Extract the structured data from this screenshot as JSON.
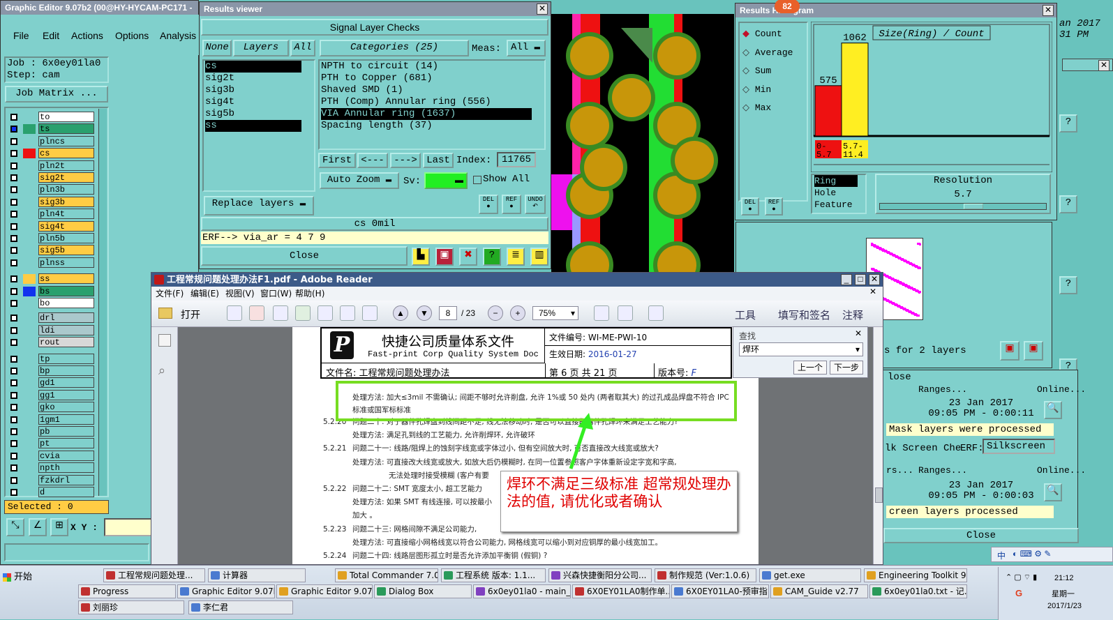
{
  "graphic_editor": {
    "title": "Graphic Editor 9.07b2 (00@HY-HYCAM-PC171 -",
    "menu": [
      "File",
      "Edit",
      "Actions",
      "Options",
      "Analysis"
    ],
    "job": "Job : 6x0ey01la0",
    "step": "Step: cam",
    "job_matrix": "Job Matrix ...",
    "layers": [
      {
        "name": "to",
        "color": "#ffffff",
        "swatch": ""
      },
      {
        "name": "ts",
        "color": "#2aa06e",
        "swatch": "#2aa06e"
      },
      {
        "name": "plncs",
        "color": "#80d0cc",
        "swatch": ""
      },
      {
        "name": "cs",
        "color": "#ffcc44",
        "swatch": "#ee1111"
      },
      {
        "name": "pln2t",
        "color": "#80d0cc",
        "swatch": ""
      },
      {
        "name": "sig2t",
        "color": "#ffcc44",
        "swatch": ""
      },
      {
        "name": "pln3b",
        "color": "#80d0cc",
        "swatch": ""
      },
      {
        "name": "sig3b",
        "color": "#ffcc44",
        "swatch": ""
      },
      {
        "name": "pln4t",
        "color": "#80d0cc",
        "swatch": ""
      },
      {
        "name": "sig4t",
        "color": "#ffcc44",
        "swatch": ""
      },
      {
        "name": "pln5b",
        "color": "#80d0cc",
        "swatch": ""
      },
      {
        "name": "sig5b",
        "color": "#ffcc44",
        "swatch": ""
      },
      {
        "name": "plnss",
        "color": "#80d0cc",
        "swatch": ""
      },
      {
        "name": "ss",
        "color": "#ffcc44",
        "swatch": "#ffcc44"
      },
      {
        "name": "bs",
        "color": "#2aa06e",
        "swatch": "#1133ee"
      },
      {
        "name": "bo",
        "color": "#ffffff",
        "swatch": ""
      },
      {
        "name": "drl",
        "color": "#aac8cc",
        "swatch": ""
      },
      {
        "name": "ldi",
        "color": "#aac8cc",
        "swatch": ""
      },
      {
        "name": "rout",
        "color": "#d8d8d8",
        "swatch": ""
      },
      {
        "name": "tp",
        "color": "#80d0cc",
        "swatch": ""
      },
      {
        "name": "bp",
        "color": "#80d0cc",
        "swatch": ""
      },
      {
        "name": "gd1",
        "color": "#80d0cc",
        "swatch": ""
      },
      {
        "name": "gg1",
        "color": "#80d0cc",
        "swatch": ""
      },
      {
        "name": "gko",
        "color": "#80d0cc",
        "swatch": ""
      },
      {
        "name": "1gm1",
        "color": "#80d0cc",
        "swatch": ""
      },
      {
        "name": "pb",
        "color": "#80d0cc",
        "swatch": ""
      },
      {
        "name": "pt",
        "color": "#80d0cc",
        "swatch": ""
      },
      {
        "name": "cvia",
        "color": "#80d0cc",
        "swatch": ""
      },
      {
        "name": "npth",
        "color": "#80d0cc",
        "swatch": ""
      },
      {
        "name": "fzkdrl",
        "color": "#80d0cc",
        "swatch": ""
      },
      {
        "name": "d",
        "color": "#80d0cc",
        "swatch": ""
      }
    ],
    "selected": "Selected : 0",
    "xy_label": "X Y :"
  },
  "results_viewer": {
    "title": "Results viewer",
    "header": "Signal Layer Checks",
    "none_btn": "None",
    "layers_btn": "Layers",
    "all_btn": "All",
    "categories_btn": "Categories (25)",
    "meas_label": "Meas:",
    "meas_value": "All",
    "layer_list": [
      "cs",
      "sig2t",
      "sig3b",
      "sig4t",
      "sig5b",
      "ss"
    ],
    "categories": [
      "NPTH to circuit (14)",
      "PTH to Copper (681)",
      "Shaved SMD (1)",
      "PTH (Comp) Annular ring (556)",
      "VIA Annular ring (1637)",
      "Spacing length (37)"
    ],
    "first": "First",
    "prev": "<---",
    "next": "--->",
    "last": "Last",
    "index_label": "Index:",
    "index_value": "11765",
    "auto_zoom": "Auto Zoom",
    "sv_label": "Sv:",
    "show_all": "Show All",
    "replace_layers": "Replace layers",
    "del": "DEL",
    "ref": "REF",
    "undo": "UNDO",
    "status": "cs 0mil",
    "erf": "ERF--> via_ar = 4 7 9",
    "close": "Close"
  },
  "histogram": {
    "title": "Results Histogram",
    "badge": "82",
    "options": [
      "Count",
      "Average",
      "Sum",
      "Min",
      "Max"
    ],
    "chart_data": {
      "type": "bar",
      "title": "Size(Ring) / Count",
      "categories": [
        "0-5.7",
        "5.7-11.4"
      ],
      "values": [
        575,
        1062
      ],
      "colors": [
        "#ee1111",
        "#ffee22"
      ]
    },
    "side_list": [
      "Ring",
      "Hole",
      "Feature"
    ],
    "resolution_label": "Resolution",
    "resolution_value": "5.7",
    "del": "DEL",
    "ref": "REF"
  },
  "bg_right": {
    "date_fragment": "an 2017",
    "time_fragment": "31 PM",
    "for_layers": "s for 2 layers",
    "close_fragment": "lose",
    "ranges": "Ranges...",
    "online": "Online...",
    "time1a": "23 Jan 2017",
    "time1b": "09:05 PM - 0:00:11",
    "mask_msg": "Mask layers were processed",
    "silk_check": "lk Screen Che",
    "erf_label": "ERF:",
    "erf_value": "Silkscreen",
    "ranges2": "Ranges...",
    "online2": "Online...",
    "rs2": "rs...",
    "time2a": "23 Jan 2017",
    "time2b": "09:05 PM - 0:00:03",
    "screen_msg": "creen layers processed",
    "close": "Close",
    "help": "?"
  },
  "adobe": {
    "title": "工程常规问题处理办法F1.pdf - Adobe Reader",
    "menu": [
      "文件(F)",
      "编辑(E)",
      "视图(V)",
      "窗口(W)",
      "帮助(H)"
    ],
    "open": "打开",
    "page_current": "8",
    "page_total": "/ 23",
    "zoom": "75%",
    "tools": "工具",
    "fill_sign": "填写和签名",
    "comment": "注释",
    "find_title": "查找",
    "find_value": "焊环",
    "find_prev": "上一个",
    "find_next": "下一步",
    "doc_header": {
      "company": "快捷公司质量体系文件",
      "company_en": "Fast-print Corp Quality System Doc",
      "doc_no_label": "文件编号:",
      "doc_no": "WI-ME-PWI-10",
      "eff_label": "生效日期:",
      "eff_date": "2016-01-27",
      "file_name": "文件名: 工程常规问题处理办法",
      "page_info": "第 6 页 共 21 页",
      "version_label": "版本号:",
      "version": "F"
    },
    "highlight_text": "处理方法: 加大≤3mil 不需确认; 间距不够时允许削盘, 允许 1%或 50 处内 (两者取其大) 的过孔成品焊盘不符合 IPC 标准或国军标标准",
    "body_lines": [
      {
        "num": "5.2.20",
        "text": "问题二十: 对于器件孔焊盘到线间距不足, 线无法移动时, 是否可以直接削器件孔焊环来满足工艺能力?"
      },
      {
        "num": "",
        "text": "处理方法: 满足孔到线的工艺能力, 允许削焊环, 允许破环"
      },
      {
        "num": "5.2.21",
        "text": "问题二十一: 线路/阻焊上的蚀刻字线宽或字体过小, 但有空间放大时, 可否直接改大线宽或放大?"
      },
      {
        "num": "",
        "text": "处理方法: 可直接改大线宽或放大, 如放大后仍模糊时, 在同一位置参照客户字体重新设定字宽和字高,"
      },
      {
        "num": "",
        "text": "无法处理时接受模糊 (客户有要"
      },
      {
        "num": "5.2.22",
        "text": "问题二十二: SMT 宽度太小, 超工艺能力"
      },
      {
        "num": "",
        "text": "处理方法: 如果 SMT 有线连接, 可以按最小"
      },
      {
        "num": "",
        "text": "加大 。"
      },
      {
        "num": "5.2.23",
        "text": "问题二十三: 网格间隙不满足公司能力,"
      },
      {
        "num": "",
        "text": "处理方法: 可直接缩小网格线宽以符合公司能力, 网格线宽可以缩小到对应铜厚的最小线宽加工。"
      },
      {
        "num": "5.2.24",
        "text": "问题二十四:  线路层图形孤立时是否允许添加平衡铜 (假铜) ?"
      }
    ],
    "annotation": "焊环不满足三级标准  超常规处理办法的值, 请优化或者确认"
  },
  "taskbar": {
    "start": "开始",
    "row1": [
      "工程常规问题处理...",
      "计算器",
      "Total Commander 7.0 p...",
      "工程系统  版本: 1.1...",
      "兴森快捷衡阳分公司...",
      "制作规范 (Ver:1.0.6)",
      "get.exe",
      "Engineering Toolkit 9.0..."
    ],
    "row2": [
      "Progress",
      "Graphic Editor 9.07b2...",
      "Graphic Editor 9.07b...",
      "Dialog Box",
      "6x0ey01la0 - main_qa",
      "6X0EY01LA0制作单...",
      "6X0EY01LA0-预审指...",
      "CAM_Guide v2.77",
      "6x0ey01la0.txt - 记..."
    ],
    "row3": [
      "刘丽珍",
      "李仁君"
    ],
    "time": "21:12",
    "weekday": "星期一",
    "date": "2017/1/23",
    "ime": "中"
  }
}
